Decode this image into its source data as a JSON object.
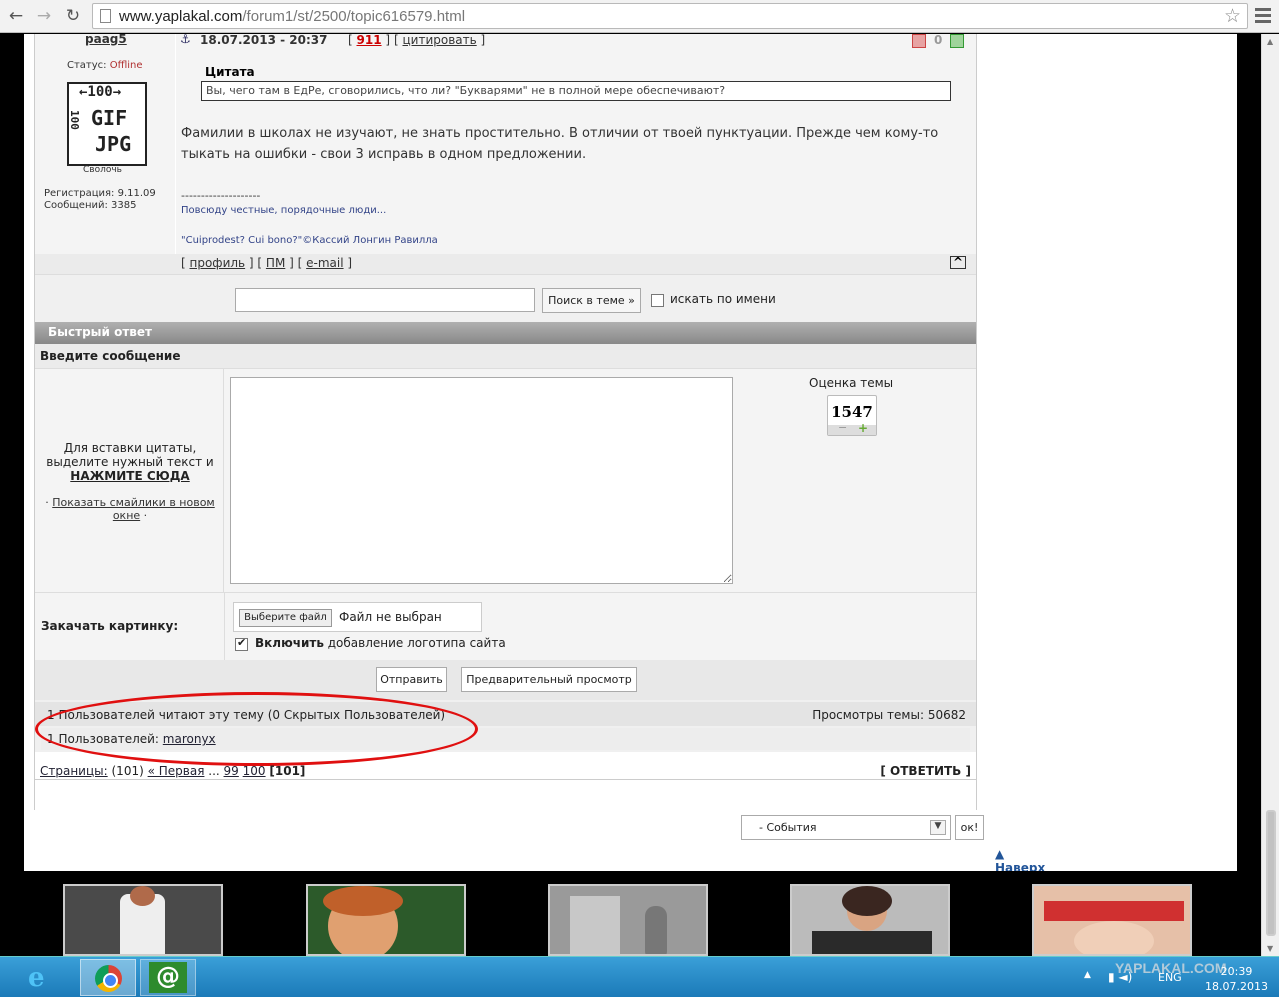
{
  "browser": {
    "url_host": "www.yaplakal.com",
    "url_path": "/forum1/st/2500/topic616579.html",
    "back_icon": "arrow-left-icon",
    "forward_icon": "arrow-right-icon",
    "reload_icon": "reload-icon",
    "star_icon": "star-icon",
    "menu_icon": "hamburger-icon"
  },
  "post": {
    "author": "paag5",
    "status_label": "Статус:",
    "status_value": "Offline",
    "avatar_text": [
      "←100→",
      "100",
      "GIF",
      "JPG"
    ],
    "rank": "Сволочь",
    "registration": "Регистрация: 9.11.09",
    "messages": "Сообщений: 3385",
    "anchor_icon": "⚓",
    "date": "18.07.2013 - 20:37",
    "number": "911",
    "cite_label": "цитировать",
    "rating": "0",
    "quote_title": "Цитата",
    "quote_text": "Вы, чего там в ЕдРе, сговорились, что ли? \"Букварями\" не в полной мере обеспечивают?",
    "body_text": "Фамилии в школах не изучают, не знать простительно. В отличии от твоей пунктуации. Прежде чем кому-то тыкать на ошибки - свои 3 исправь в одном предложении.",
    "sig_line": "--------------------",
    "sig1": "Повсюду честные, порядочные люди...",
    "sig2": "\"Cuiprodest? Cui bono?\"©Кассий Лонгин Равилла",
    "link_profile": "профиль",
    "link_pm": "ПМ",
    "link_email": "e-mail",
    "top_label": "^"
  },
  "search": {
    "value": "",
    "button": "Поиск в теме »",
    "by_name_label": "искать по имени",
    "by_name_checked": false
  },
  "quick_reply": {
    "title": "Быстрый ответ",
    "subtitle": "Введите сообщение",
    "hint": "Для вставки цитаты, выделите нужный текст и",
    "hint_bold": "НАЖМИТЕ СЮДА",
    "smiles_link": "Показать смайлики в новом окне",
    "rating_label": "Оценка темы",
    "rating_value": "1547",
    "rating_minus": "−",
    "rating_plus": "+",
    "message_value": ""
  },
  "upload": {
    "label": "Закачать картинку:",
    "file_button": "Выберите файл",
    "file_status": "Файл не выбран",
    "logo_bold": "Включить",
    "logo_rest": " добавление логотипа сайта",
    "logo_checked": true
  },
  "actions": {
    "send": "Отправить",
    "preview": "Предварительный просмотр"
  },
  "readers": {
    "reading": "1 Пользователей читают эту тему (0 Скрытых Пользователей)",
    "views": "Просмотры темы: 50682",
    "users_prefix": "1 Пользователей: ",
    "user": "maronyx"
  },
  "pagination": {
    "pages_label": "Страницы:",
    "count": "(101)",
    "first": "« Первая",
    "ellipsis": "...",
    "p99": "99",
    "p100": "100",
    "current": "[101]",
    "reply": "[ ОТВЕТИТЬ ]"
  },
  "footer": {
    "events_value": "- События",
    "ok": "ок!",
    "to_top": "Наверх",
    "to_top_icon": "triangle-up-icon"
  },
  "taskbar": {
    "lang": "ENG",
    "time": "20:39",
    "date": "18.07.2013",
    "watermark": "YAPLAKAL.COM"
  }
}
